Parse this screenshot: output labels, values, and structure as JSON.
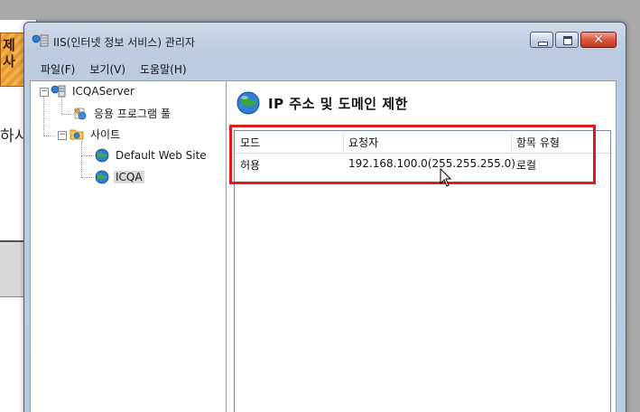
{
  "background_window": {
    "banner_lines": [
      "제",
      "사"
    ],
    "side_text": "하시"
  },
  "window": {
    "title": "IIS(인터넷 정보 서비스) 관리자",
    "controls": {
      "close_glyph": "✕"
    }
  },
  "menu": {
    "items": [
      "파일(F)",
      "보기(V)",
      "도움말(H)"
    ]
  },
  "tree": {
    "root": {
      "label": "ICQAServer",
      "expander": "−"
    },
    "app_pool": {
      "label": "응용 프로그램 풀"
    },
    "sites": {
      "label": "사이트",
      "expander": "−"
    },
    "default_site": {
      "label": "Default Web Site"
    },
    "icqa": {
      "label": "ICQA",
      "selected": true
    }
  },
  "pane": {
    "title": "IP 주소 및 도메인 제한",
    "columns": [
      "모드",
      "요청자",
      "항목 유형"
    ],
    "rows": [
      {
        "mode": "허용",
        "requestor": "192.168.100.0(255.255.255.0)",
        "entry_type": "로컬"
      }
    ]
  },
  "colors": {
    "highlight": "#e01919",
    "title_bar": "#c5d4ea",
    "selection": "#d9d9d9"
  }
}
